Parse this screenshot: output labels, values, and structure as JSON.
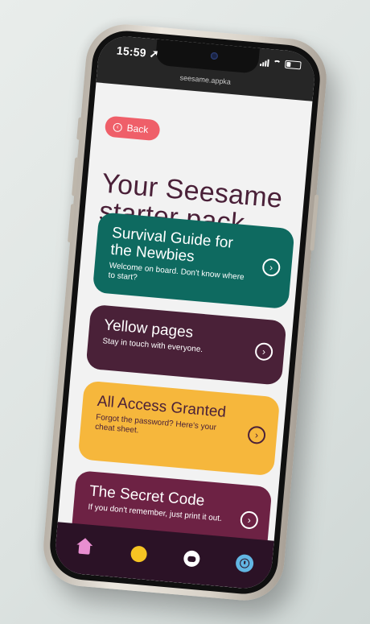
{
  "status": {
    "time": "15:59 ➚",
    "url": "seesame.appka"
  },
  "back_button": {
    "label": "Back"
  },
  "page_title": "Your Seesame starter pack",
  "cards": [
    {
      "title": "Survival Guide for the Newbies",
      "subtitle": "Welcome on board. Don't know where to start?",
      "color": "#0e6a60"
    },
    {
      "title": "Yellow pages",
      "subtitle": "Stay in touch with everyone.",
      "color": "#4a2138"
    },
    {
      "title": "All Access Granted",
      "subtitle": "Forgot the password? Here's your cheat sheet.",
      "color": "#f6b73c"
    },
    {
      "title": "The Secret Code",
      "subtitle": "If you don't remember, just print it out.",
      "color": "#6d2244"
    }
  ],
  "tabbar": {
    "tabs": [
      {
        "icon": "home-icon",
        "color": "#e88ed0"
      },
      {
        "icon": "yellow-dot-icon",
        "color": "#f6c423"
      },
      {
        "icon": "chat-icon",
        "color": "#ffffff"
      },
      {
        "icon": "clock-icon",
        "color": "#62b6e3"
      }
    ]
  },
  "colors": {
    "accent": "#ef5f69",
    "title": "#4a2038",
    "tabbar_bg": "#2b1226"
  }
}
